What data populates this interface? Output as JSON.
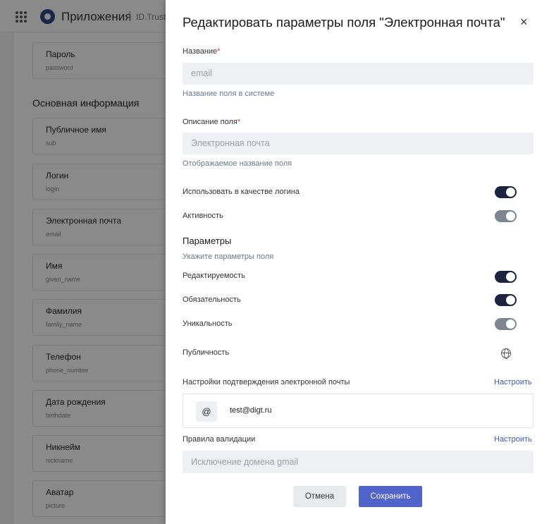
{
  "app": {
    "title": "Приложения",
    "separator": "|",
    "subtitle": "ID.Truste"
  },
  "background": {
    "section_title": "Основная информация",
    "fields": [
      {
        "label": "Пароль",
        "name": "password"
      },
      {
        "label": "Публичное имя",
        "name": "sub"
      },
      {
        "label": "Логин",
        "name": "login"
      },
      {
        "label": "Электронная почта",
        "name": "email"
      },
      {
        "label": "Имя",
        "name": "given_name"
      },
      {
        "label": "Фамилия",
        "name": "family_name"
      },
      {
        "label": "Телефон",
        "name": "phone_number"
      },
      {
        "label": "Дата рождения",
        "name": "birthdate"
      },
      {
        "label": "Никнейм",
        "name": "nickname"
      },
      {
        "label": "Аватар",
        "name": "picture"
      }
    ]
  },
  "drawer": {
    "title": "Редактировать параметры поля \"Электронная почта\"",
    "close_glyph": "×",
    "name_label": "Название",
    "name_required": "*",
    "name_value": "email",
    "name_help": "Название поля в системе",
    "desc_label": "Описание поля",
    "desc_required": "*",
    "desc_value": "Электронная почта",
    "desc_help": "Отображаемое название поля",
    "toggles": [
      {
        "label": "Использовать в качестве логина",
        "state": "on"
      },
      {
        "label": "Активность",
        "state": "disabled-on"
      }
    ],
    "params_title": "Параметры",
    "params_help": "Укажите параметры поля",
    "param_toggles": [
      {
        "label": "Редактируемость",
        "state": "on"
      },
      {
        "label": "Обязательность",
        "state": "on"
      },
      {
        "label": "Уникальность",
        "state": "disabled-on"
      }
    ],
    "publicity_label": "Публичность",
    "confirm_label": "Настройки подтверждения электронной почты",
    "confirm_link": "Настроить",
    "confirm_badge": "@",
    "confirm_email": "test@digt.ru",
    "validation_label": "Правила валидации",
    "validation_link": "Настроить",
    "validation_value": "Исключение домена gmail",
    "cancel_label": "Отмена",
    "save_label": "Сохранить"
  },
  "colors": {
    "accent": "#5064cc",
    "toggle_on": "#1c2440",
    "toggle_disabled": "#7e8490",
    "required": "#e0333a",
    "link": "#3a5aa8"
  }
}
